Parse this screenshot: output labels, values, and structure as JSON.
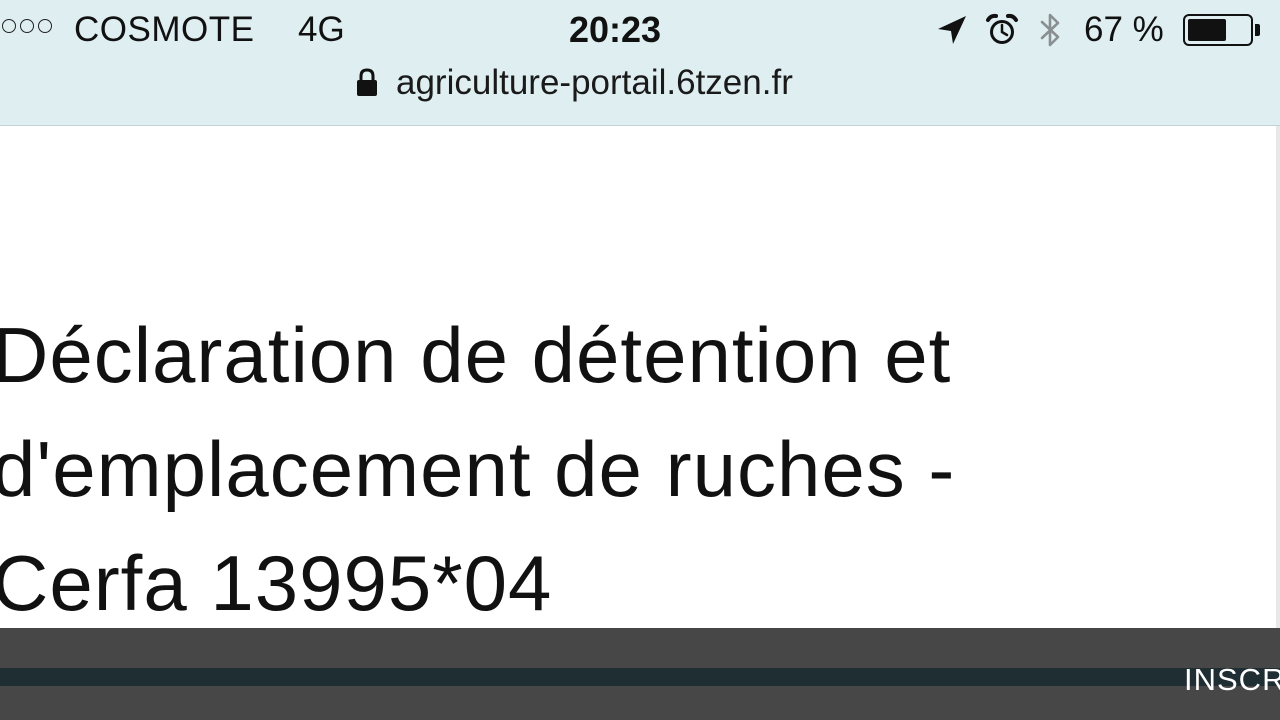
{
  "status_bar": {
    "carrier": "COSMOTE",
    "network": "4G",
    "time": "20:23",
    "battery_percent": "67 %",
    "battery_level": 0.67,
    "signal_dots": 3,
    "icons": [
      "location-arrow-icon",
      "alarm-clock-icon",
      "bluetooth-icon",
      "battery-icon"
    ]
  },
  "address_bar": {
    "url": "agriculture-portail.6tzen.fr",
    "icon": "lock-icon"
  },
  "page": {
    "title_lines": [
      "Déclaration de détention et",
      "d'emplacement de ruches -",
      "Cerfa 13995*04"
    ]
  },
  "bottom_bar": {
    "label": "INSCRI"
  },
  "colors": {
    "topbar_bg": "#deeef1",
    "page_bg": "#ffffff",
    "bottom_bar_bg": "#474747",
    "bottom_stripe": "#1f2e33",
    "text": "#111111"
  }
}
